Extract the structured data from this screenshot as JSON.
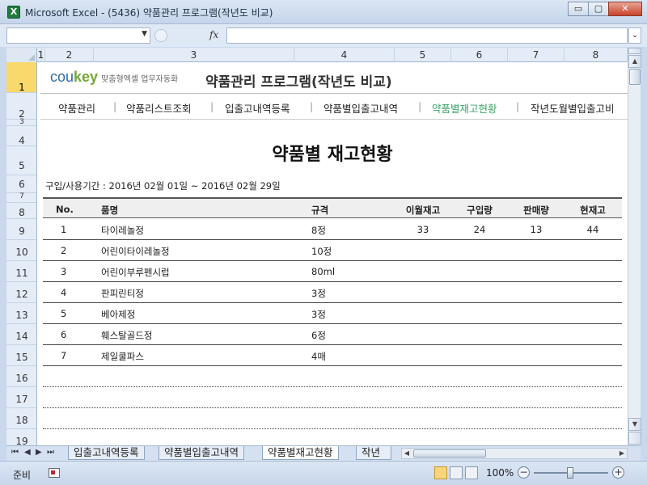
{
  "window": {
    "title": "Microsoft Excel - (5436) 약품관리 프로그램(작년도 비교)",
    "minimize": "▭",
    "restore": "▢",
    "close": "✕"
  },
  "formula_bar": {
    "name_box": "",
    "fx": "fx",
    "formula": ""
  },
  "columns": [
    "1",
    "2",
    "3",
    "4",
    "5",
    "6",
    "7",
    "8"
  ],
  "rows": [
    "1",
    "2",
    "3",
    "4",
    "5",
    "6",
    "7",
    "8",
    "9",
    "10",
    "11",
    "12",
    "13",
    "14",
    "15",
    "16",
    "17",
    "18",
    "19"
  ],
  "brand": {
    "cou": "cou",
    "key": "key",
    "sub": "맞춤형엑셀 업무자동화"
  },
  "app_title": "약품관리 프로그램(작년도 비교)",
  "nav": [
    {
      "label": "약품관리"
    },
    {
      "label": "약품리스트조회"
    },
    {
      "label": "입출고내역등록"
    },
    {
      "label": "약품별입출고내역"
    },
    {
      "label": "약품별재고현황",
      "active": true
    },
    {
      "label": "작년도월별입출고비"
    }
  ],
  "nav_separator": "|",
  "page_title": "약품별 재고현황",
  "period": "구입/사용기간 : 2016년 02월 01일 ~ 2016년 02월 29일",
  "table": {
    "headers": [
      "No.",
      "품명",
      "규격",
      "이월재고",
      "구입량",
      "판매량",
      "현재고"
    ],
    "rows": [
      [
        "1",
        "타이레놀정",
        "8정",
        "33",
        "24",
        "13",
        "44"
      ],
      [
        "2",
        "어린이타이레놀정",
        "10정",
        "",
        "",
        "",
        ""
      ],
      [
        "3",
        "어린이부루펜시럽",
        "80ml",
        "",
        "",
        "",
        ""
      ],
      [
        "4",
        "판피린티정",
        "3정",
        "",
        "",
        "",
        ""
      ],
      [
        "5",
        "베아제정",
        "3정",
        "",
        "",
        "",
        ""
      ],
      [
        "6",
        "훼스탈골드정",
        "6정",
        "",
        "",
        "",
        ""
      ],
      [
        "7",
        "제일쿨파스",
        "4매",
        "",
        "",
        "",
        ""
      ]
    ]
  },
  "sheet_tabs": [
    "입출고내역등록",
    "약품별입출고내역",
    "약품별재고현황",
    "작년"
  ],
  "active_tab": "약품별재고현황",
  "tab_nav": [
    "⏮",
    "◀",
    "▶",
    "⏭"
  ],
  "status": {
    "ready": "준비",
    "zoom": "100%",
    "zoom_minus": "−",
    "zoom_plus": "+",
    "zoom_level": 1.0
  }
}
